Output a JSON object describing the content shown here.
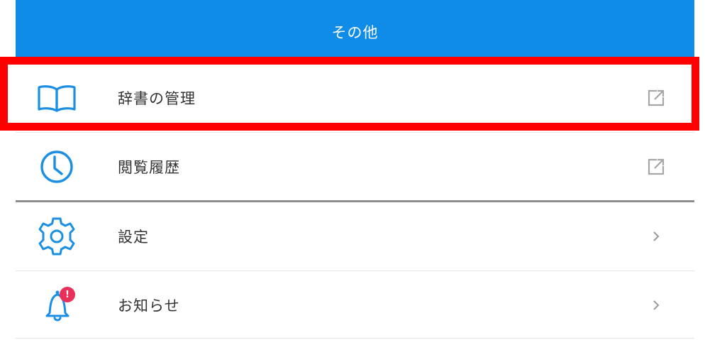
{
  "header": {
    "title": "その他"
  },
  "menu": {
    "items": [
      {
        "label": "辞書の管理",
        "icon": "book-icon",
        "trailing": "external-link-icon"
      },
      {
        "label": "閲覧履歴",
        "icon": "clock-icon",
        "trailing": "external-link-icon"
      },
      {
        "label": "設定",
        "icon": "gear-icon",
        "trailing": "chevron-right-icon"
      },
      {
        "label": "お知らせ",
        "icon": "bell-icon",
        "trailing": "chevron-right-icon",
        "badge": "!"
      }
    ]
  },
  "colors": {
    "header_bg": "#0f8ce8",
    "icon_blue": "#1a8fe3",
    "badge": "#e8305a",
    "highlight": "#ff0000"
  }
}
